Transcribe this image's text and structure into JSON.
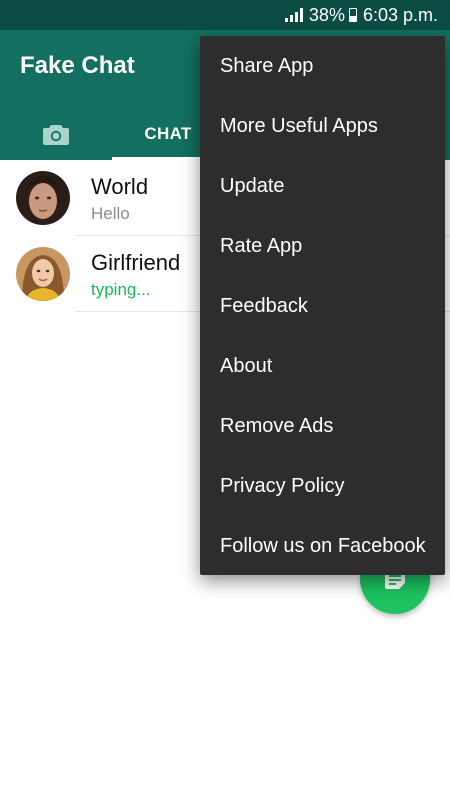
{
  "status_bar": {
    "battery": "38%",
    "time": "6:03 p.m."
  },
  "app_bar": {
    "title": "Fake Chat",
    "tabs": [
      {
        "icon": "camera-icon"
      },
      {
        "label": "CHAT",
        "selected": true
      }
    ]
  },
  "chats": [
    {
      "name": "World",
      "message": "Hello",
      "typing": false
    },
    {
      "name": "Girlfriend",
      "message": "typing...",
      "typing": true
    }
  ],
  "menu": {
    "items": [
      "Share App",
      "More Useful Apps",
      "Update",
      "Rate App",
      "Feedback",
      "About",
      "Remove Ads",
      "Privacy Policy",
      "Follow us on Facebook"
    ]
  },
  "fab": {
    "icon": "new-chat-icon"
  },
  "colors": {
    "status_bar": "#0b4d43",
    "app_bar": "#136f5f",
    "typing_green": "#1db954",
    "fab_green": "#1dc35f",
    "menu_background": "#2d2d2d"
  }
}
